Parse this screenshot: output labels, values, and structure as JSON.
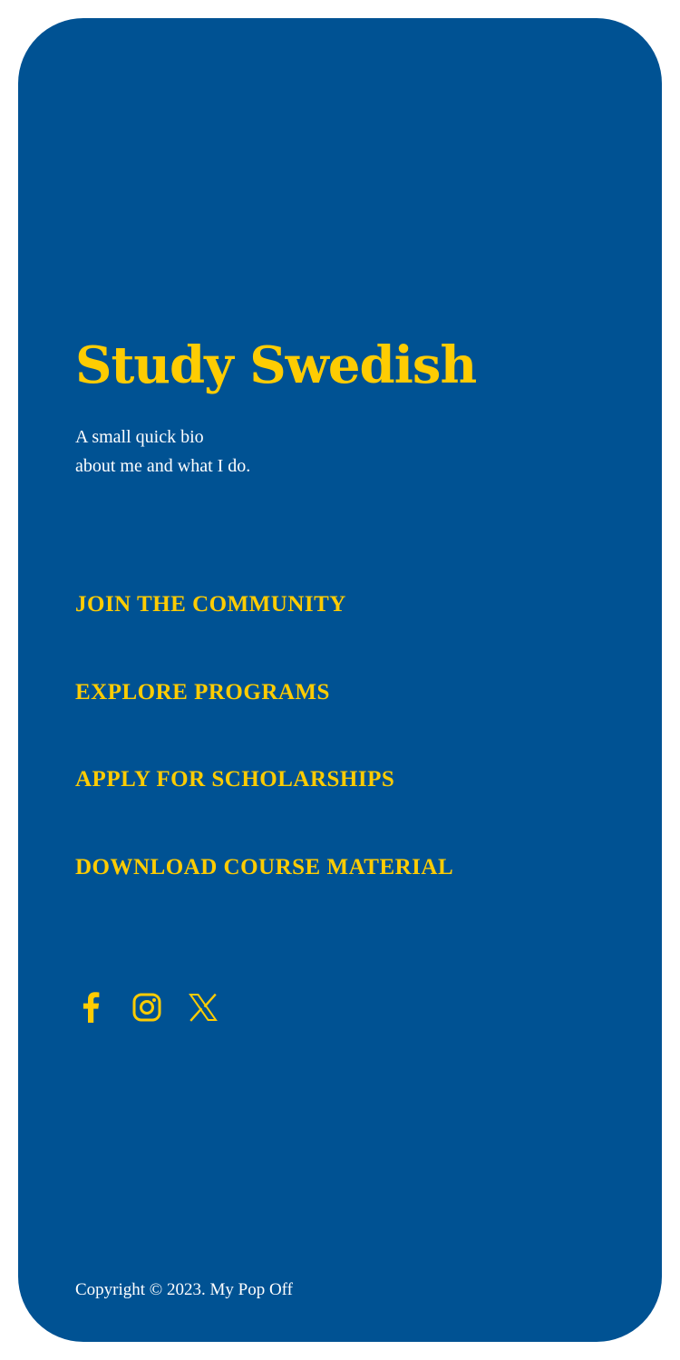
{
  "header": {
    "title": "Study Swedish",
    "bio_line_1": "A small quick bio",
    "bio_line_2": "about me and what I do."
  },
  "nav": {
    "items": [
      {
        "label": "JOIN THE COMMUNITY"
      },
      {
        "label": "EXPLORE PROGRAMS"
      },
      {
        "label": "APPLY FOR SCHOLARSHIPS"
      },
      {
        "label": "DOWNLOAD COURSE MATERIAL"
      }
    ]
  },
  "social": {
    "icons": [
      "facebook-icon",
      "instagram-icon",
      "x-icon"
    ]
  },
  "footer": {
    "copyright": "Copyright © 2023. My Pop Off"
  },
  "colors": {
    "card_background": "#005293",
    "accent": "#FECC02",
    "text": "#FFFFFF",
    "page_background": "#FFFFFF"
  }
}
